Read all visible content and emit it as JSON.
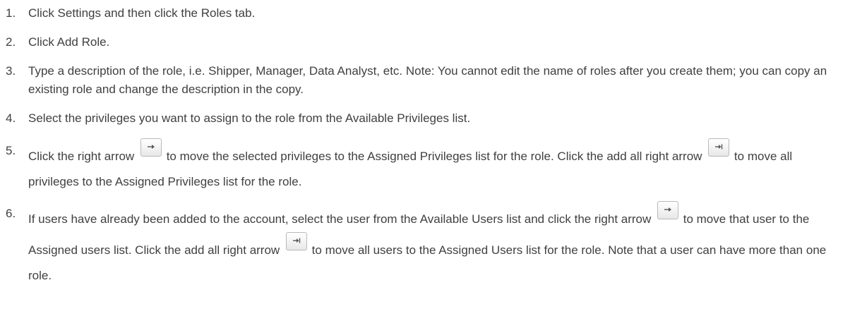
{
  "steps": [
    {
      "number": "1.",
      "text": "Click Settings and then click the Roles tab."
    },
    {
      "number": "2.",
      "text": "Click Add Role."
    },
    {
      "number": "3.",
      "text": "Type a description of the role, i.e. Shipper, Manager, Data Analyst, etc. Note: You cannot edit the name of roles after you create them; you can copy an existing role and change the description in the copy."
    },
    {
      "number": "4.",
      "text": "Select the privileges you want to assign to the role from the Available Privileges list."
    },
    {
      "number": "5.",
      "text_a": "Click the right arrow",
      "text_b": "to move the selected privileges to the Assigned Privileges list for the role. Click the add all right arrow",
      "text_c": "to move all privileges to the Assigned Privileges list for the role."
    },
    {
      "number": "6.",
      "text_a": "If users have already been added to the account, select the user from the Available Users list and click the right arrow",
      "text_b": "to move that user to the Assigned users list. Click the add all right arrow",
      "text_c": "to move all users to the Assigned Users list for the role. Note that a user can have more than one role."
    }
  ],
  "icons": {
    "right_arrow": "right-arrow-icon",
    "add_all_right_arrow": "add-all-right-arrow-icon"
  }
}
